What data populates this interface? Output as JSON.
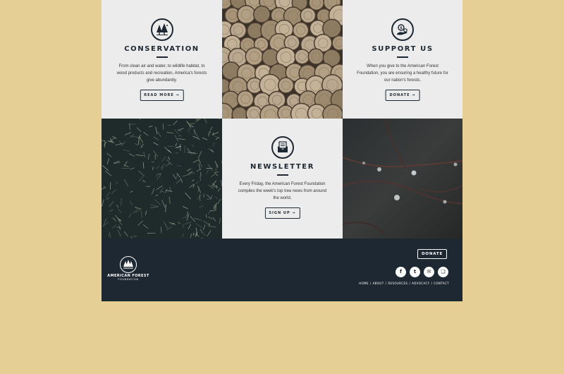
{
  "colors": {
    "background": "#e6cf94",
    "card": "#ececec",
    "ink": "#1d2731",
    "footer": "#1e2833"
  },
  "conservation": {
    "icon": "forest-trees-icon",
    "title": "CONSERVATION",
    "body": "From clean air and water, to wildlife habitat, to wood products and recreation, America's forests give abundantly.",
    "button": "READ MORE →"
  },
  "support": {
    "icon": "hand-coin-icon",
    "title": "SUPPORT US",
    "body": "When you give to the American Forest Foundation, you are ensuring a healthy future for our nation's forests.",
    "button": "DONATE →"
  },
  "newsletter": {
    "icon": "envelope-icon",
    "title": "NEWSLETTER",
    "body": "Every Friday, the American Forest Foundation compiles the week's top tree news from around the world.",
    "button": "SIGN UP →"
  },
  "photos": {
    "logs": "stacked-logs-photo",
    "pine": "pine-branches-photo",
    "branch": "thorny-branch-droplets-photo"
  },
  "footer": {
    "logo_icon": "forest-trees-icon",
    "logo_title": "AMERICAN FOREST",
    "logo_sub": "FOUNDATION",
    "donate": "DONATE",
    "socials": [
      {
        "icon": "facebook-icon",
        "glyph": "f"
      },
      {
        "icon": "twitter-icon",
        "glyph": "t"
      },
      {
        "icon": "email-icon",
        "glyph": "✉"
      },
      {
        "icon": "bookmark-icon",
        "glyph": "❏"
      }
    ],
    "nav": [
      "HOME",
      "ABOUT",
      "RESOURCES",
      "ADVOCACY",
      "CONTACT"
    ]
  }
}
